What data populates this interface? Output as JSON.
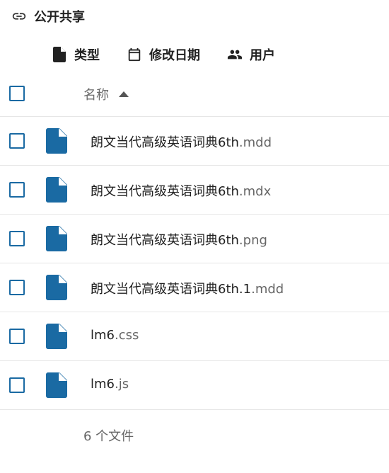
{
  "header": {
    "title": "公开共享",
    "icon": "link-icon"
  },
  "filters": [
    {
      "label": "类型",
      "icon": "file-icon"
    },
    {
      "label": "修改日期",
      "icon": "calendar-icon"
    },
    {
      "label": "用户",
      "icon": "people-icon"
    }
  ],
  "columns": {
    "name_label": "名称",
    "sort": "ascending"
  },
  "files": [
    {
      "base": "朗文当代高级英语词典6th",
      "ext": ".mdd"
    },
    {
      "base": "朗文当代高级英语词典6th",
      "ext": ".mdx"
    },
    {
      "base": "朗文当代高级英语词典6th",
      "ext": ".png"
    },
    {
      "base": "朗文当代高级英语词典6th.1",
      "ext": ".mdd"
    },
    {
      "base": "lm6",
      "ext": ".css"
    },
    {
      "base": "lm6",
      "ext": ".js"
    }
  ],
  "footer": {
    "count_text": "6 个文件"
  },
  "colors": {
    "accent": "#1a6aa3",
    "file_icon": "#1a6aa3"
  }
}
